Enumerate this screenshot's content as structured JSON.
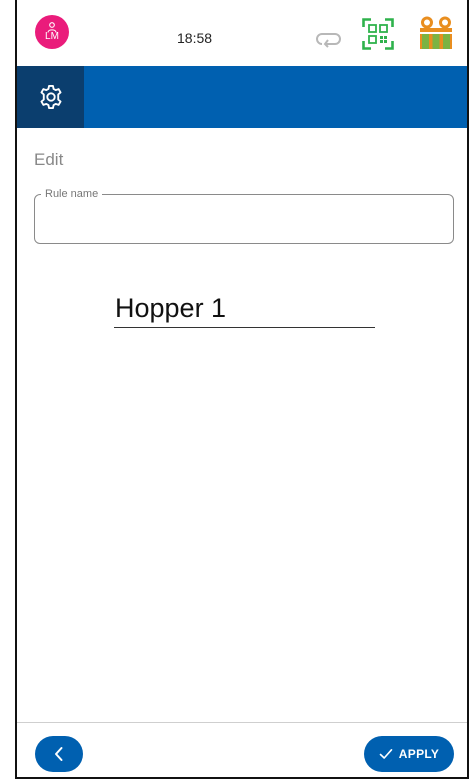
{
  "status_bar": {
    "avatar_initials": "LM",
    "time": "18:58",
    "icons": [
      "user-icon",
      "sync-icon",
      "qr-code-icon",
      "cabinet-icon"
    ]
  },
  "header": {
    "settings_icon": "gear-icon"
  },
  "main": {
    "title": "Edit",
    "rule_name_label": "Rule name",
    "rule_name_value": "",
    "rule_display_value": "Hopper 1"
  },
  "footer": {
    "back_icon": "chevron-left-icon",
    "apply_label": "APPLY"
  },
  "colors": {
    "brand_blue": "#0060b0",
    "header_dark": "#0b3e6e",
    "avatar_pink": "#ea1c7b",
    "qr_green": "#2fb24c",
    "cabinet_orange": "#e98e1f",
    "cabinet_green": "#7cb342"
  }
}
